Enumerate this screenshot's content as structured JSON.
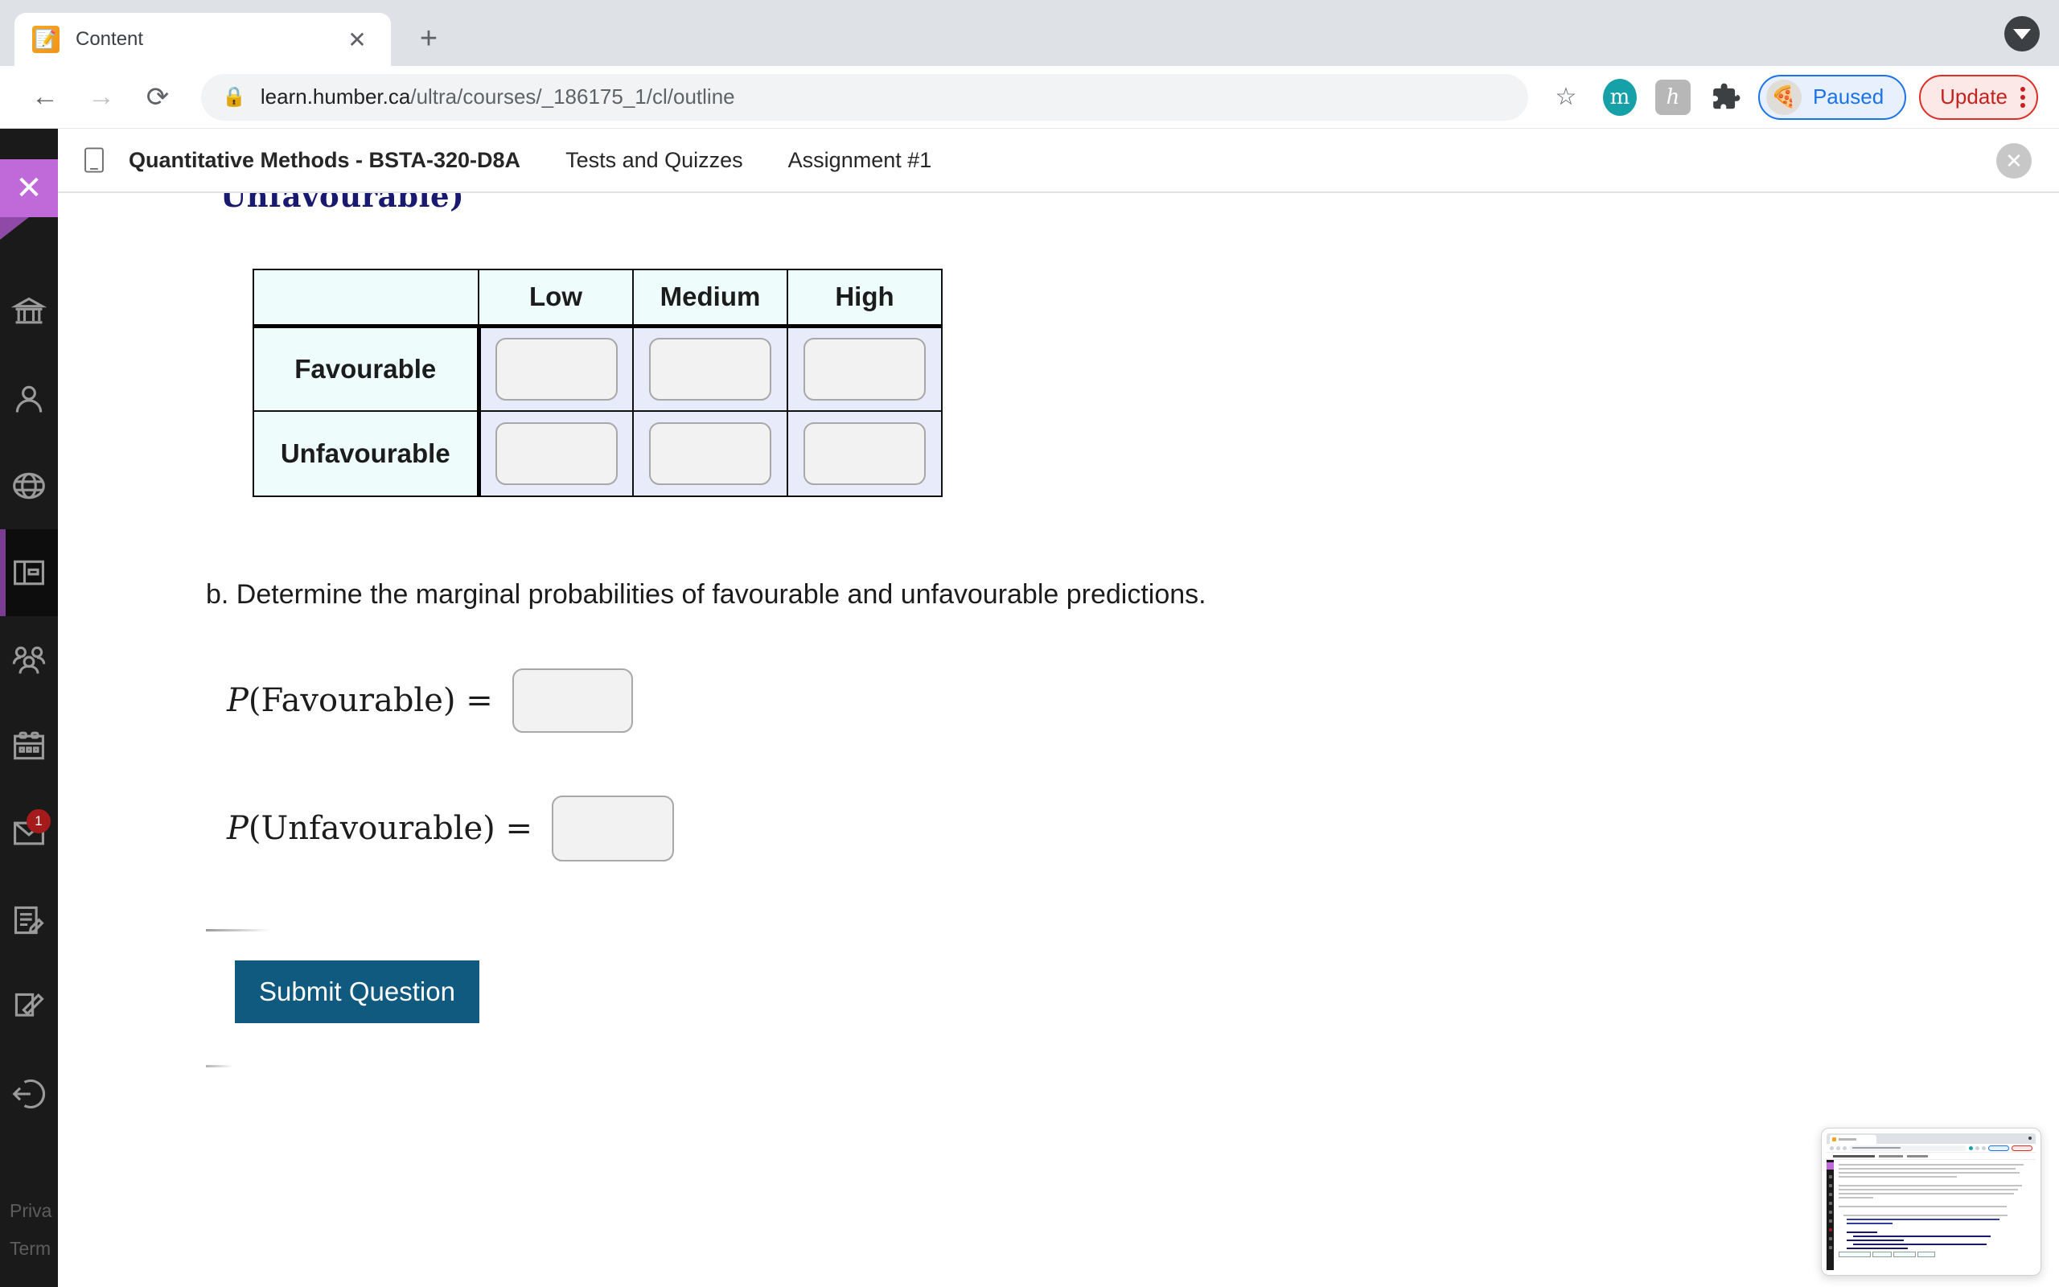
{
  "browser": {
    "tab": {
      "title": "Content",
      "favicon_icon": "pencil-note-icon",
      "close_icon": "close-icon"
    },
    "newtab_icon": "plus-icon",
    "window_control_icon": "chevron-down-circle-icon",
    "nav": {
      "back_icon": "arrow-left-icon",
      "forward_icon": "arrow-right-icon",
      "reload_icon": "reload-icon"
    },
    "omnibox": {
      "lock_icon": "lock-icon",
      "url_host": "learn.humber.ca",
      "url_path": "/ultra/courses/_186175_1/cl/outline"
    },
    "actions": {
      "bookmark_icon": "star-icon",
      "profile_badge": "m",
      "honey_badge": "h",
      "extensions_icon": "puzzle-piece-icon",
      "paused_label": "Paused",
      "paused_avatar_icon": "pizza-icon",
      "update_label": "Update",
      "menu_icon": "kebab-menu-icon"
    },
    "colors": {
      "paused_accent": "#1a73e8",
      "update_accent": "#d93025",
      "tabstrip_bg": "#dee1e6"
    }
  },
  "rail": {
    "close_icon": "close-icon",
    "items": [
      {
        "name": "institution",
        "icon": "institution-icon"
      },
      {
        "name": "profile",
        "icon": "person-icon"
      },
      {
        "name": "activity-stream",
        "icon": "globe-icon"
      },
      {
        "name": "courses",
        "icon": "courses-panel-icon",
        "active": true
      },
      {
        "name": "organizations",
        "icon": "people-group-icon"
      },
      {
        "name": "calendar",
        "icon": "calendar-icon"
      },
      {
        "name": "messages",
        "icon": "envelope-icon",
        "badge": "1"
      },
      {
        "name": "grades",
        "icon": "grades-document-icon"
      },
      {
        "name": "tools",
        "icon": "edit-square-icon"
      },
      {
        "name": "sign-out",
        "icon": "sign-out-icon"
      }
    ],
    "footer_links": [
      "Priva",
      "Term"
    ]
  },
  "breadcrumb": {
    "doc_icon": "document-icon",
    "course_title": "Quantitative Methods - BSTA-320-D8A",
    "links": [
      "Tests and Quizzes",
      "Assignment #1"
    ],
    "close_icon": "close-circle-icon"
  },
  "question": {
    "clipped_text": "Unfavourable)",
    "table": {
      "corner_label": "",
      "column_headers": [
        "Low",
        "Medium",
        "High"
      ],
      "rows": [
        {
          "label": "Favourable",
          "cells": [
            "",
            "",
            ""
          ]
        },
        {
          "label": "Unfavourable",
          "cells": [
            "",
            "",
            ""
          ]
        }
      ],
      "header_bg": "#eefcfc",
      "cell_bg": "#e8ebfa"
    },
    "part_b_text": "b. Determine the marginal probabilities of favourable and unfavourable predictions.",
    "equations": [
      {
        "prefix": "P",
        "body": "(Favourable)",
        "equals": "=",
        "value": ""
      },
      {
        "prefix": "P",
        "body": "(Unfavourable)",
        "equals": "=",
        "value": ""
      }
    ],
    "submit_label": "Submit Question",
    "submit_color": "#10597f"
  },
  "thumbnail": {
    "name": "page-preview-thumbnail"
  }
}
